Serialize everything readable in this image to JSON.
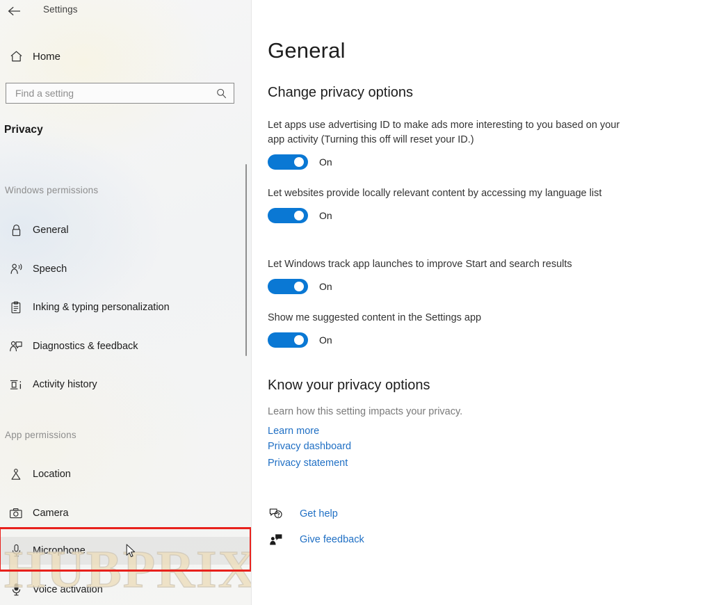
{
  "window": {
    "app_title": "Settings",
    "back_icon": "back-arrow-icon"
  },
  "sidebar": {
    "home": {
      "label": "Home",
      "icon": "home-icon"
    },
    "search": {
      "placeholder": "Find a setting",
      "value": "",
      "icon": "search-icon"
    },
    "category_heading": "Privacy",
    "groups": [
      {
        "label": "Windows permissions",
        "items": [
          {
            "label": "General",
            "icon": "lock-icon"
          },
          {
            "label": "Speech",
            "icon": "speech-person-icon"
          },
          {
            "label": "Inking & typing personalization",
            "icon": "clipboard-icon"
          },
          {
            "label": "Diagnostics & feedback",
            "icon": "person-feedback-icon"
          },
          {
            "label": "Activity history",
            "icon": "activity-history-icon"
          }
        ]
      },
      {
        "label": "App permissions",
        "items": [
          {
            "label": "Location",
            "icon": "location-pin-person-icon"
          },
          {
            "label": "Camera",
            "icon": "camera-icon"
          },
          {
            "label": "Microphone",
            "icon": "microphone-icon"
          },
          {
            "label": "Voice activation",
            "icon": "voice-activation-icon"
          }
        ]
      }
    ]
  },
  "annotation": {
    "highlight_color": "#e8211c",
    "highlighted_item": "Microphone"
  },
  "watermark": {
    "text": "HUBPRIX"
  },
  "main": {
    "page_title": "General",
    "sections": [
      {
        "title": "Change privacy options",
        "settings": [
          {
            "description": "Let apps use advertising ID to make ads more interesting to you based on your app activity (Turning this off will reset your ID.)",
            "toggle_state": "On"
          },
          {
            "description": "Let websites provide locally relevant content by accessing my language list",
            "toggle_state": "On"
          },
          {
            "description": "Let Windows track app launches to improve Start and search results",
            "toggle_state": "On"
          },
          {
            "description": "Show me suggested content in the Settings app",
            "toggle_state": "On"
          }
        ]
      },
      {
        "title": "Know your privacy options",
        "subtitle": "Learn how this setting impacts your privacy.",
        "links": [
          {
            "label": "Learn more"
          },
          {
            "label": "Privacy dashboard"
          },
          {
            "label": "Privacy statement"
          }
        ]
      }
    ],
    "help": [
      {
        "label": "Get help",
        "icon": "question-bubble-icon"
      },
      {
        "label": "Give feedback",
        "icon": "feedback-person-icon"
      }
    ]
  },
  "colors": {
    "toggle_on": "#0a78d4",
    "link": "#1f6fc4",
    "annotation": "#e8211c"
  }
}
